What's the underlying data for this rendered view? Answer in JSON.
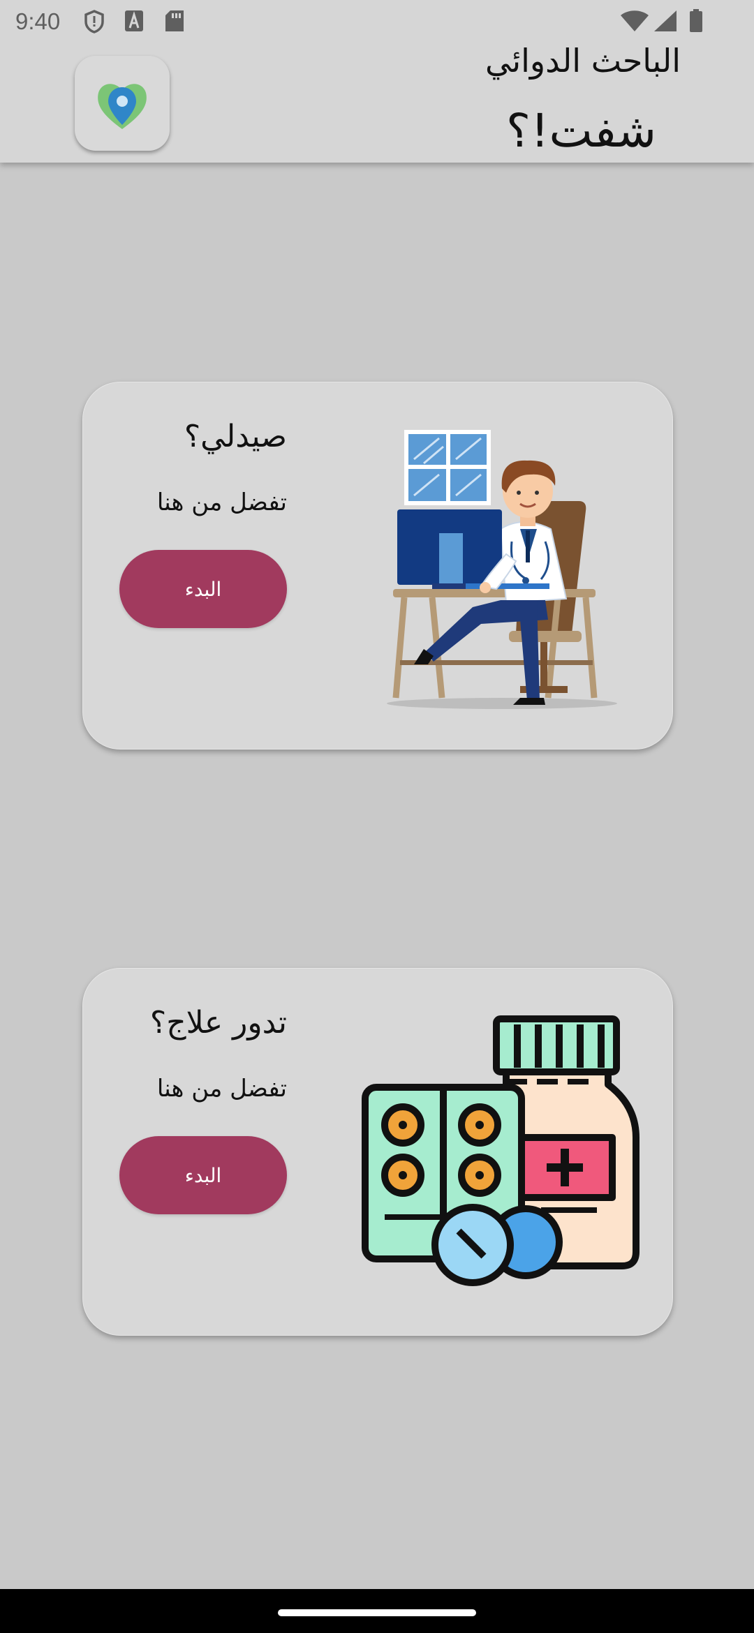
{
  "status_bar": {
    "time": "9:40",
    "icons": [
      "shield-icon",
      "font-a-icon",
      "sd-card-icon",
      "wifi-icon",
      "signal-icon",
      "battery-icon"
    ]
  },
  "header": {
    "subtitle": "الباحث الدوائي",
    "title": "شفت!؟",
    "logo_icon": "location-heart-logo"
  },
  "cards": [
    {
      "title": "صيدلي؟",
      "text": "تفضل من هنا",
      "button_label": "البدء",
      "illustration": "pharmacist-at-desk-illustration"
    },
    {
      "title": "تدور علاج؟",
      "text": "تفضل من هنا",
      "button_label": "البدء",
      "illustration": "medicine-bottle-and-pills-illustration"
    }
  ],
  "colors": {
    "background": "#c9c9c9",
    "header": "#d6d6d6",
    "card": "#d8d8d8",
    "button": "#a13a5e"
  }
}
